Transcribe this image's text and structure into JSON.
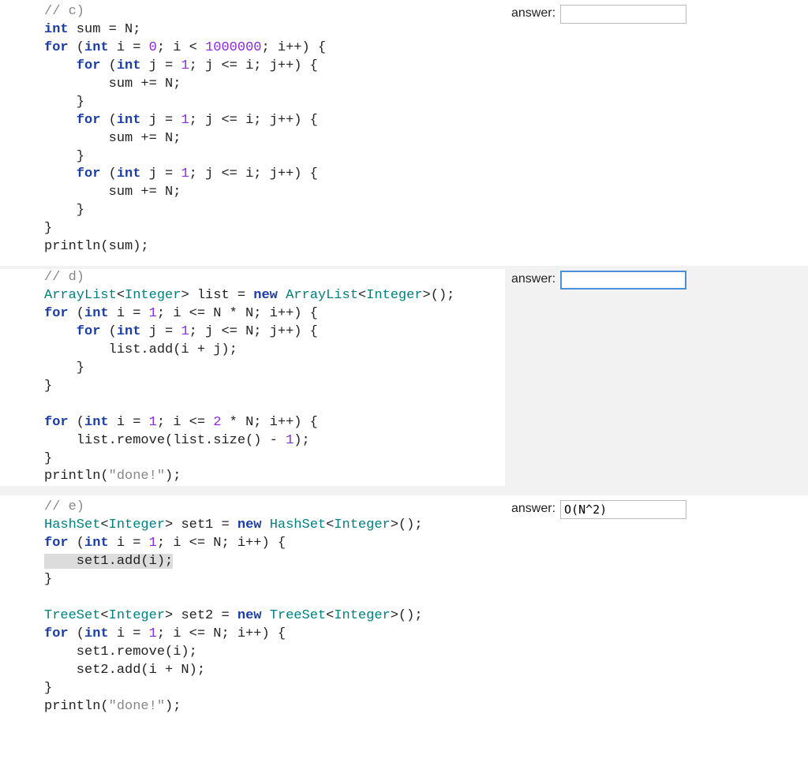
{
  "answer_label": "answer:",
  "c": {
    "comment": "// c)",
    "l1_a": "int",
    "l1_b": " sum = N;",
    "l2_a": "for",
    "l2_b": " (",
    "l2_c": "int",
    "l2_d": " i = ",
    "l2_e": "0",
    "l2_f": "; i < ",
    "l2_g": "1000000",
    "l2_h": "; i++) {",
    "l3_a": "    for",
    "l3_b": " (",
    "l3_c": "int",
    "l3_d": " j = ",
    "l3_e": "1",
    "l3_f": "; j <= i; j++) {",
    "l4": "        sum += N;",
    "l5": "    }",
    "l6_a": "    for",
    "l6_b": " (",
    "l6_c": "int",
    "l6_d": " j = ",
    "l6_e": "1",
    "l6_f": "; j <= i; j++) {",
    "l7": "        sum += N;",
    "l8": "    }",
    "l9_a": "    for",
    "l9_b": " (",
    "l9_c": "int",
    "l9_d": " j = ",
    "l9_e": "1",
    "l9_f": "; j <= i; j++) {",
    "l10": "        sum += N;",
    "l11": "    }",
    "l12": "}",
    "l13": "println(sum);",
    "answer": ""
  },
  "d": {
    "comment": "// d)",
    "l1_a": "ArrayList",
    "l1_b": "<",
    "l1_c": "Integer",
    "l1_d": "> list = ",
    "l1_e": "new",
    "l1_f": " ",
    "l1_g": "ArrayList",
    "l1_h": "<",
    "l1_i": "Integer",
    "l1_j": ">();",
    "l2_a": "for",
    "l2_b": " (",
    "l2_c": "int",
    "l2_d": " i = ",
    "l2_e": "1",
    "l2_f": "; i <= N * N; i++) {",
    "l3_a": "    for",
    "l3_b": " (",
    "l3_c": "int",
    "l3_d": " j = ",
    "l3_e": "1",
    "l3_f": "; j <= N; j++) {",
    "l4": "        list.add(i + j);",
    "l5": "    }",
    "l6": "}",
    "blank1": "",
    "l7_a": "for",
    "l7_b": " (",
    "l7_c": "int",
    "l7_d": " i = ",
    "l7_e": "1",
    "l7_f": "; i <= ",
    "l7_g": "2",
    "l7_h": " * N; i++) {",
    "l8_a": "    list.remove(list.size() - ",
    "l8_b": "1",
    "l8_c": ");",
    "l9": "}",
    "l10_a": "println(",
    "l10_b": "\"done!\"",
    "l10_c": ");",
    "answer": ""
  },
  "e": {
    "comment": "// e)",
    "l1_a": "HashSet",
    "l1_b": "<",
    "l1_c": "Integer",
    "l1_d": "> set1 = ",
    "l1_e": "new",
    "l1_f": " ",
    "l1_g": "HashSet",
    "l1_h": "<",
    "l1_i": "Integer",
    "l1_j": ">();",
    "l2_a": "for",
    "l2_b": " (",
    "l2_c": "int",
    "l2_d": " i = ",
    "l2_e": "1",
    "l2_f": "; i <= N; i++) {",
    "l3": "    set1.add(i);",
    "l4": "}",
    "blank1": "",
    "l5_a": "TreeSet",
    "l5_b": "<",
    "l5_c": "Integer",
    "l5_d": "> set2 = ",
    "l5_e": "new",
    "l5_f": " ",
    "l5_g": "TreeSet",
    "l5_h": "<",
    "l5_i": "Integer",
    "l5_j": ">();",
    "l6_a": "for",
    "l6_b": " (",
    "l6_c": "int",
    "l6_d": " i = ",
    "l6_e": "1",
    "l6_f": "; i <= N; i++) {",
    "l7": "    set1.remove(i);",
    "l8": "    set2.add(i + N);",
    "l9": "}",
    "l10_a": "println(",
    "l10_b": "\"done!\"",
    "l10_c": ");",
    "answer": "O(N^2)"
  }
}
